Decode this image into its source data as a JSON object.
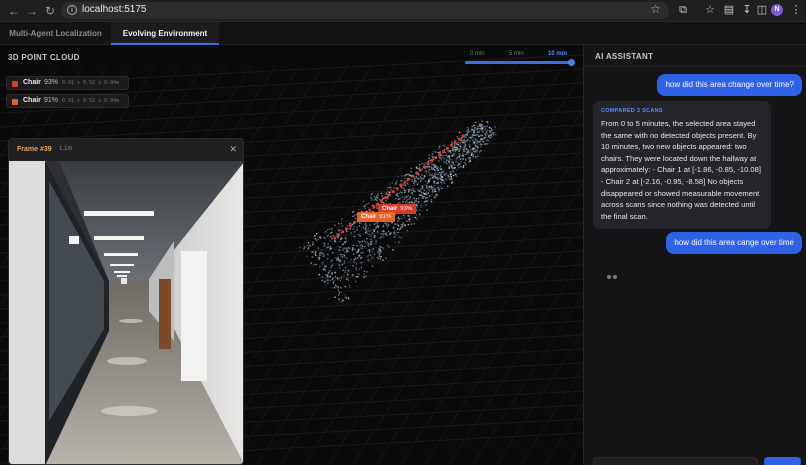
{
  "browser": {
    "url": "localhost:5175",
    "profile_initial": "N"
  },
  "app_tabs": [
    {
      "label": "Multi-Agent Localization",
      "active": false
    },
    {
      "label": "Evolving Environment",
      "active": true
    }
  ],
  "point_cloud": {
    "title": "3D POINT CLOUD",
    "time_slider": {
      "labels": [
        "0 min",
        "5 min",
        "10 min"
      ],
      "selected": "10 min",
      "value_fraction": 1.0
    },
    "legend": [
      {
        "name": "Chair",
        "confidence": "93%",
        "dims": "0.91 x 0.52 x 0.94m",
        "color": "#d63a2a"
      },
      {
        "name": "Chair",
        "confidence": "91%",
        "dims": "0.91 x 0.52 x 0.94m",
        "color": "#e2632b"
      }
    ],
    "object_tags": [
      {
        "name": "Chair",
        "confidence": "93%",
        "color": "#d63a2a"
      },
      {
        "name": "Chair",
        "confidence": "91%",
        "color": "#e2632b"
      }
    ]
  },
  "frame_panel": {
    "title": "Frame #39",
    "distance": "1.1m",
    "close_icon": "close-icon"
  },
  "assistant": {
    "title": "AI ASSISTANT",
    "messages": [
      {
        "role": "user",
        "text": "how did this area change over time?"
      },
      {
        "role": "assistant",
        "label": "COMPARED 3 SCANS",
        "text": "From 0 to 5 minutes, the selected area stayed the same with no detected objects present. By 10 minutes, two new objects appeared: two chairs. They were located down the hallway at approximately: - Chair 1 at [-1.86, -0.85, -10.08] - Chair 2 at [-2.16, -0.95, -8.58] No objects disappeared or showed measurable movement across scans since nothing was detected until the final scan."
      },
      {
        "role": "user",
        "text": "how did this area cange over time"
      }
    ],
    "typing_indicator": true
  },
  "colors": {
    "accent": "#2f62e6",
    "frame_title": "#f0a35a"
  }
}
